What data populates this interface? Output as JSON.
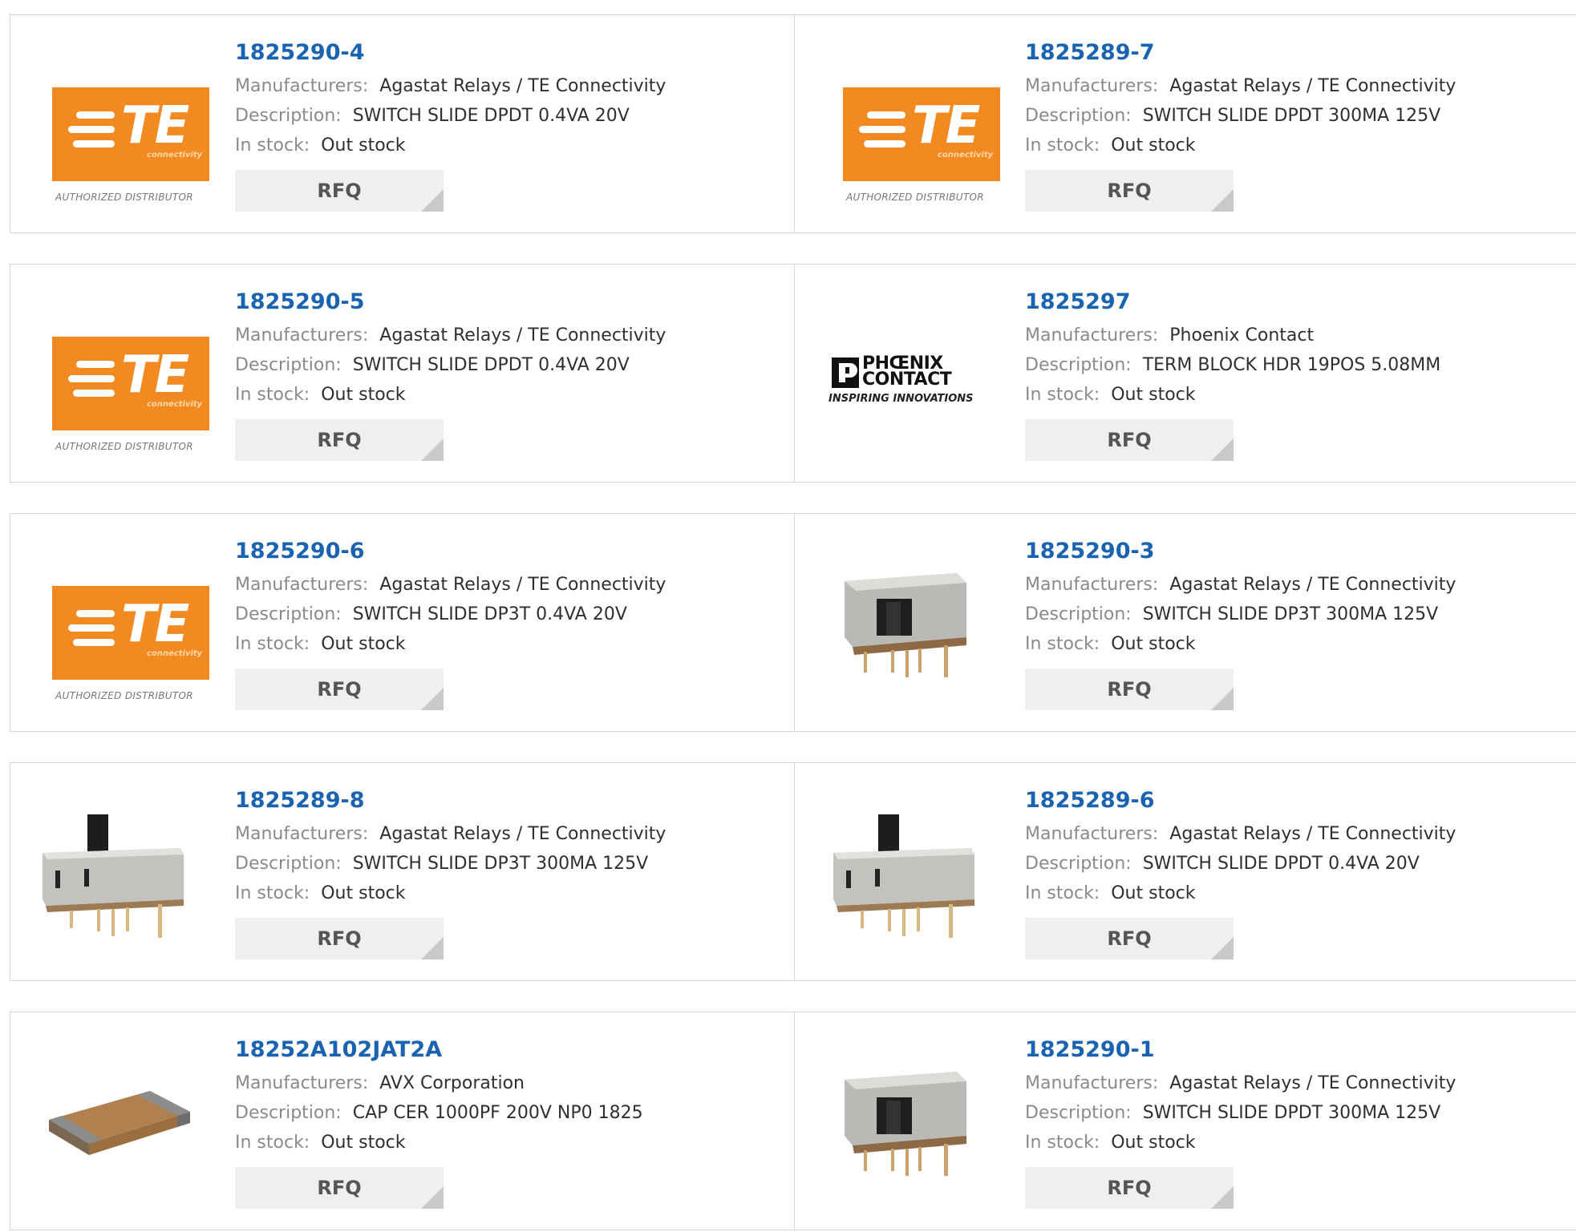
{
  "labels": {
    "manufacturers": "Manufacturers:",
    "description": "Description:",
    "in_stock": "In stock:",
    "rfq": "RFQ"
  },
  "logo_text": {
    "te": "TE",
    "te_sub": "connectivity",
    "te_authorized": "AUTHORIZED DISTRIBUTOR",
    "phoenix_line1": "PHŒNIX",
    "phoenix_line2": "CONTACT",
    "phoenix_tagline": "INSPIRING INNOVATIONS"
  },
  "colors": {
    "part_link": "#1a63b0",
    "te_orange": "#f28a21",
    "rfq_bg": "#efefef"
  },
  "products": [
    {
      "part": "1825290-4",
      "manufacturer": "Agastat Relays / TE Connectivity",
      "description": "SWITCH SLIDE DPDT 0.4VA 20V",
      "stock": "Out stock",
      "image": "te-logo"
    },
    {
      "part": "1825289-7",
      "manufacturer": "Agastat Relays / TE Connectivity",
      "description": "SWITCH SLIDE DPDT 300MA 125V",
      "stock": "Out stock",
      "image": "te-logo"
    },
    {
      "part": "1825290-5",
      "manufacturer": "Agastat Relays / TE Connectivity",
      "description": "SWITCH SLIDE DPDT 0.4VA 20V",
      "stock": "Out stock",
      "image": "te-logo"
    },
    {
      "part": "1825297",
      "manufacturer": "Phoenix Contact",
      "description": "TERM BLOCK HDR 19POS 5.08MM",
      "stock": "Out stock",
      "image": "phoenix-logo"
    },
    {
      "part": "1825290-6",
      "manufacturer": "Agastat Relays / TE Connectivity",
      "description": "SWITCH SLIDE DP3T 0.4VA 20V",
      "stock": "Out stock",
      "image": "te-logo"
    },
    {
      "part": "1825290-3",
      "manufacturer": "Agastat Relays / TE Connectivity",
      "description": "SWITCH SLIDE DP3T 300MA 125V",
      "stock": "Out stock",
      "image": "slide-switch-photo"
    },
    {
      "part": "1825289-8",
      "manufacturer": "Agastat Relays / TE Connectivity",
      "description": "SWITCH SLIDE DP3T 300MA 125V",
      "stock": "Out stock",
      "image": "tall-slide-switch-photo"
    },
    {
      "part": "1825289-6",
      "manufacturer": "Agastat Relays / TE Connectivity",
      "description": "SWITCH SLIDE DPDT 0.4VA 20V",
      "stock": "Out stock",
      "image": "tall-slide-switch-photo"
    },
    {
      "part": "18252A102JAT2A",
      "manufacturer": "AVX Corporation",
      "description": "CAP CER 1000PF 200V NP0 1825",
      "stock": "Out stock",
      "image": "ceramic-capacitor-photo"
    },
    {
      "part": "1825290-1",
      "manufacturer": "Agastat Relays / TE Connectivity",
      "description": "SWITCH SLIDE DPDT 300MA 125V",
      "stock": "Out stock",
      "image": "slide-switch-photo"
    }
  ]
}
